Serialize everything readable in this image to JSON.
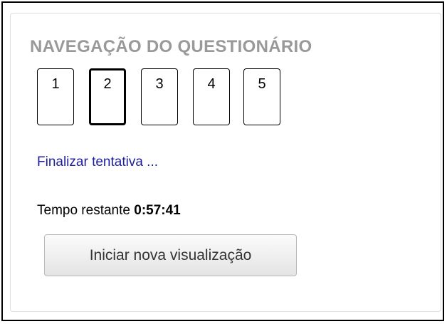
{
  "quiz_navigation": {
    "title": "NAVEGAÇÃO DO QUESTIONÁRIO",
    "questions": [
      {
        "label": "1",
        "current": false
      },
      {
        "label": "2",
        "current": true
      },
      {
        "label": "3",
        "current": false
      },
      {
        "label": "4",
        "current": false
      },
      {
        "label": "5",
        "current": false
      }
    ],
    "finish_link": "Finalizar tentativa ...",
    "timer_label": "Tempo restante",
    "timer_value": "0:57:41",
    "preview_button": "Iniciar nova visualização"
  },
  "colors": {
    "title": "#999999",
    "link": "#1d1d9c",
    "border": "#000000"
  }
}
